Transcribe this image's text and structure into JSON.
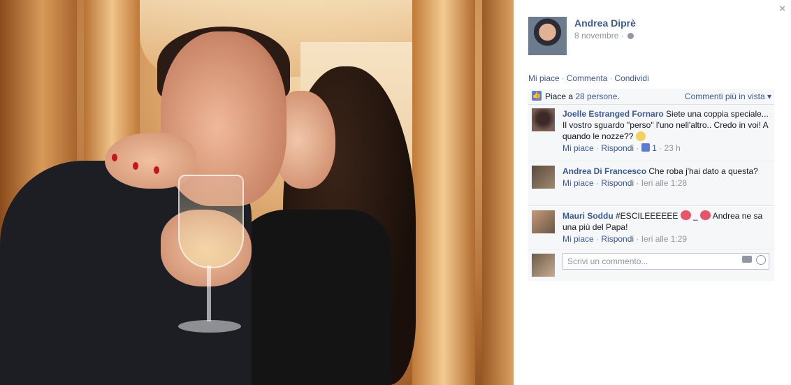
{
  "post": {
    "author": "Andrea Diprè",
    "date": "8 novembre",
    "date_suffix": "·",
    "actions": [
      "Mi piace",
      "Commenta",
      "Condividi"
    ],
    "likes_prefix": "Piace a ",
    "likes_link": "28 persone",
    "likes_suffix": ".",
    "sort_label": "Commenti più in vista ▾",
    "close_symbol": "×"
  },
  "comments": [
    {
      "author": "Joelle Estranged Fornaro",
      "text": " Siete una coppia speciale... Il vostro sguardo \"perso\" l'uno nell'altro.. Credo in voi! A quando le nozze?? ",
      "like": "Mi piace",
      "reply": "Rispondi",
      "like_count": "1",
      "time": "23 h"
    },
    {
      "author": "Andrea Di Francesco",
      "text": " Che roba j'hai dato a questa?",
      "like": "Mi piace",
      "reply": "Rispondi",
      "time": "Ieri alle 1:28"
    },
    {
      "author": "Mauri Soddu",
      "text_a": " #ESCILEEEEEE ",
      "text_b": " _ ",
      "text_c": " Andrea ne sa una più del Papa!",
      "like": "Mi piace",
      "reply": "Rispondi",
      "time": "Ieri alle 1:29"
    }
  ],
  "composer": {
    "placeholder": "Scrivi un commento..."
  },
  "colors": {
    "link": "#3b5998",
    "muted": "#9197a3",
    "panel_bg": "#f6f7f9"
  },
  "icons": [
    "close-icon",
    "globe-icon",
    "thumbs-up-icon",
    "heart-icon",
    "smiley-icon",
    "camera-icon",
    "emoticon-icon"
  ]
}
